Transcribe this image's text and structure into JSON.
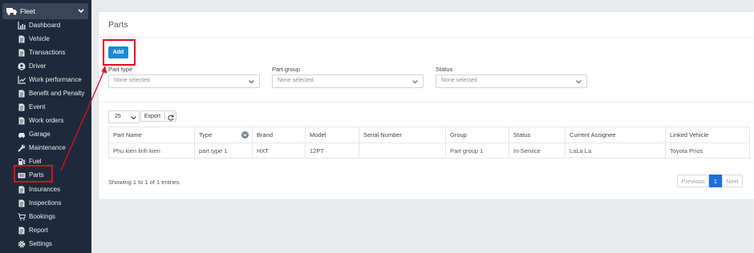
{
  "sidebar": {
    "group_title": "Fleet",
    "items": [
      {
        "label": "Dashboard",
        "icon": "chart-icon"
      },
      {
        "label": "Vehicle",
        "icon": "document-icon"
      },
      {
        "label": "Transactions",
        "icon": "document-icon"
      },
      {
        "label": "Driver",
        "icon": "user-circle-icon"
      },
      {
        "label": "Work performance",
        "icon": "line-chart-icon"
      },
      {
        "label": "Benefit and Penalty",
        "icon": "document-icon"
      },
      {
        "label": "Event",
        "icon": "document-icon"
      },
      {
        "label": "Work orders",
        "icon": "document-icon"
      },
      {
        "label": "Garage",
        "icon": "car-icon"
      },
      {
        "label": "Maintenance",
        "icon": "wrench-icon"
      },
      {
        "label": "Fuel",
        "icon": "fuel-icon"
      },
      {
        "label": "Parts",
        "icon": "parts-icon"
      },
      {
        "label": "Insurances",
        "icon": "document-icon"
      },
      {
        "label": "Inspections",
        "icon": "document-icon"
      },
      {
        "label": "Bookings",
        "icon": "cart-icon"
      },
      {
        "label": "Report",
        "icon": "document-icon"
      },
      {
        "label": "Settings",
        "icon": "gear-icon"
      }
    ]
  },
  "page": {
    "title": "Parts",
    "add_label": "Add"
  },
  "filters": {
    "part_type": {
      "label": "Part type",
      "placeholder": "None selected"
    },
    "part_group": {
      "label": "Part group",
      "placeholder": "None selected"
    },
    "status": {
      "label": "Status",
      "placeholder": "None selected"
    }
  },
  "toolbar": {
    "page_length": "25",
    "export_label": "Export"
  },
  "table": {
    "headers": [
      "Part Name",
      "Type",
      "Brand",
      "Model",
      "Serial Number",
      "Group",
      "Status",
      "Current Assignee",
      "Linked Vehicle"
    ],
    "rows": [
      [
        "Phu kien linh kien",
        "part type 1",
        "HXT",
        "12PT",
        "",
        "Part group 1",
        "In-Service",
        "LaLa La",
        "Toyota Prius"
      ]
    ]
  },
  "footer": {
    "showing": "Showing 1 to 1 of 1 entries",
    "previous": "Previous",
    "current_page": "1",
    "next": "Next"
  },
  "colors": {
    "sidebar_bg": "#1e2a3b",
    "accent": "#1f88d2",
    "link": "#2767c8",
    "annotation": "#e00c1c"
  }
}
